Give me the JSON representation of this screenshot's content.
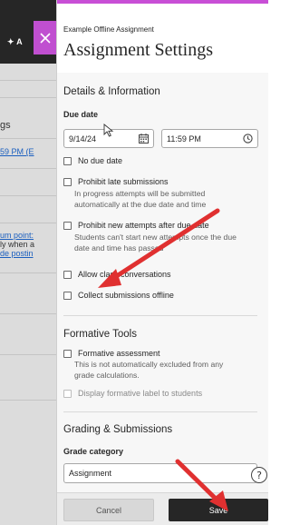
{
  "background": {
    "add_label": "A",
    "heading_fragment": "gs",
    "date_fragment": "59 PM (E",
    "text_lines": [
      "um point:",
      "ly when a",
      "de postin"
    ]
  },
  "panel": {
    "subtitle": "Example Offline Assignment",
    "title": "Assignment Settings"
  },
  "details": {
    "heading": "Details & Information",
    "due_date_label": "Due date",
    "date_value": "9/14/24",
    "time_value": "11:59 PM",
    "no_due_date": "No due date",
    "prohibit_late": "Prohibit late submissions",
    "prohibit_late_hint": [
      "In progress attempts will be submitted",
      "automatically at the due date and time"
    ],
    "prohibit_new": "Prohibit new attempts after due date",
    "prohibit_new_hint": [
      "Students can't start new attempts once the due",
      "date and time has passed"
    ],
    "allow_class": "Allow class conversations",
    "collect_offline": "Collect submissions offline"
  },
  "formative": {
    "heading": "Formative Tools",
    "formative_assessment": "Formative assessment",
    "formative_hint": [
      "This is not automatically excluded from any",
      "grade calculations."
    ],
    "display_label": "Display formative label to students"
  },
  "grading": {
    "heading": "Grading & Submissions",
    "grade_category_label": "Grade category",
    "grade_category_value": "Assignment"
  },
  "footer": {
    "cancel": "Cancel",
    "save": "Save"
  },
  "colors": {
    "accent": "#c84fd6",
    "arrow": "#e03030",
    "save_bg": "#262626"
  }
}
